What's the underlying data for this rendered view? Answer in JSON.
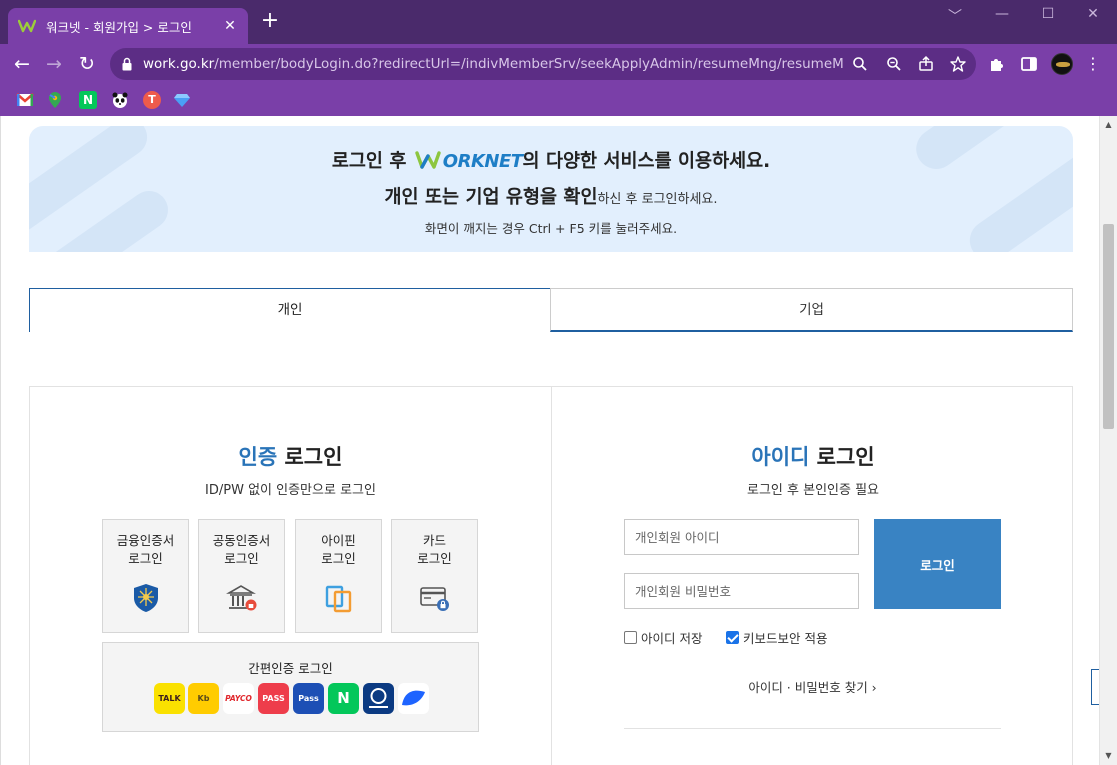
{
  "browser": {
    "tab_title": "워크넷 - 회원가입 > 로그인",
    "tab_close": "✕",
    "new_tab": "+",
    "url_host": "work.go.kr",
    "url_path": "/member/bodyLogin.do?redirectUrl=/indivMemberSrv/seekApplyAdmin/resumeMng/resumeMng...",
    "window_controls": [
      "﹀",
      "—",
      "☐",
      "✕"
    ],
    "bookmarks": [
      "gmail-icon",
      "maps-icon",
      "naver-icon",
      "panda-icon",
      "tmap-icon",
      "diamond-icon"
    ]
  },
  "banner": {
    "line1_pre": "로그인 후 ",
    "logo_text": "ORKNET",
    "line1_post": "의 다양한 서비스를 이용하세요.",
    "line2_bold": "개인 또는 기업 유형을 확인",
    "line2_small": "하신 후 로그인하세요.",
    "line3": "화면이 깨지는 경우 Ctrl + F5 키를 눌러주세요."
  },
  "tabs": {
    "person": "개인",
    "company": "기업"
  },
  "cert_login": {
    "title_accent": "인증",
    "title_rest": " 로그인",
    "subtitle": "ID/PW 없이 인증만으로 로그인",
    "boxes": [
      {
        "label": "금융인증서\n로그인",
        "icon": "financial-cert-icon"
      },
      {
        "label": "공동인증서\n로그인",
        "icon": "joint-cert-icon"
      },
      {
        "label": "아이핀\n로그인",
        "icon": "ipin-icon"
      },
      {
        "label": "카드\n로그인",
        "icon": "card-icon"
      }
    ],
    "easy_title": "간편인증 로그인",
    "easy_items": [
      {
        "label": "TALK",
        "icon": "kakao-icon",
        "bg": "#fae100",
        "fg": "#3c1e1e"
      },
      {
        "label": "Kb",
        "icon": "kb-icon",
        "bg": "#ffcc00",
        "fg": "#5a4a1a"
      },
      {
        "label": "PAYCO",
        "icon": "payco-icon",
        "bg": "#ffffff",
        "fg": "#e0262b"
      },
      {
        "label": "PASS",
        "icon": "pass-icon",
        "bg": "#ee3d4b",
        "fg": "#ffffff"
      },
      {
        "label": "Pass",
        "icon": "samsung-pass-icon",
        "bg": "#1d4fb5",
        "fg": "#ffffff"
      },
      {
        "label": "N",
        "icon": "naver-cert-icon",
        "bg": "#03c75a",
        "fg": "#ffffff"
      },
      {
        "label": "",
        "icon": "shinhan-icon",
        "bg": "#0b3a82",
        "fg": "#ffffff"
      },
      {
        "label": "",
        "icon": "toss-icon",
        "bg": "#ffffff",
        "fg": "#1e64ff"
      }
    ]
  },
  "id_login": {
    "title_accent": "아이디",
    "title_rest": " 로그인",
    "subtitle": "로그인 후 본인인증 필요",
    "id_placeholder": "개인회원 아이디",
    "pw_placeholder": "개인회원 비밀번호",
    "login_button": "로그인",
    "save_id_label": "아이디 저장",
    "save_id_checked": false,
    "keyboard_security_label": "키보드보안 적용",
    "keyboard_security_checked": true,
    "find_link": "아이디 · 비밀번호 찾기  ›"
  },
  "colors": {
    "accent_blue": "#2a74b8",
    "login_button": "#3983c3",
    "browser_purple": "#7a3fa8",
    "banner_bg": "#e2effd"
  }
}
